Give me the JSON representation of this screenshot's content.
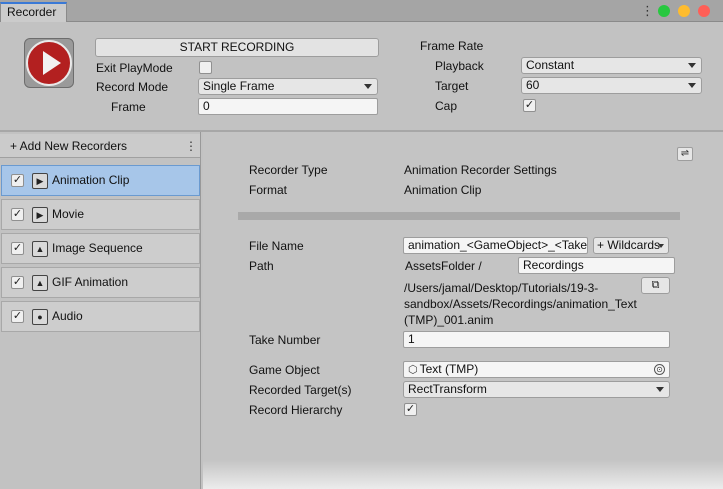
{
  "window": {
    "tab_title": "Recorder",
    "more_icon": "⋮",
    "traffic_lights": [
      "#28c840",
      "#febc2e",
      "#ff5f57"
    ]
  },
  "top": {
    "record_icon": "play-record-icon",
    "start_label": "START RECORDING",
    "exit_playmode_label": "Exit PlayMode",
    "exit_playmode_checked": false,
    "record_mode_label": "Record Mode",
    "record_mode_value": "Single Frame",
    "frame_label": "Frame",
    "frame_value": "0",
    "frame_rate_label": "Frame Rate",
    "playback_label": "Playback",
    "playback_value": "Constant",
    "target_label": "Target",
    "target_value": "60",
    "cap_label": "Cap",
    "cap_checked": true,
    "check_glyph": "✓"
  },
  "left": {
    "add_label": "+ Add New Recorders",
    "menu_icon": "⋮",
    "recorders": [
      {
        "label": "Animation Clip",
        "icon": "animation-clip-icon",
        "glyph": "▶",
        "checked": true,
        "selected": true
      },
      {
        "label": "Movie",
        "icon": "movie-icon",
        "glyph": "▶",
        "checked": true,
        "selected": false
      },
      {
        "label": "Image Sequence",
        "icon": "image-sequence-icon",
        "glyph": "▲",
        "checked": true,
        "selected": false
      },
      {
        "label": "GIF Animation",
        "icon": "gif-animation-icon",
        "glyph": "▲",
        "checked": true,
        "selected": false
      },
      {
        "label": "Audio",
        "icon": "audio-icon",
        "glyph": "●",
        "checked": true,
        "selected": false
      }
    ]
  },
  "right": {
    "settings_icon": "⇌",
    "recorder_type_label": "Recorder Type",
    "recorder_type_value": "Animation Recorder Settings",
    "format_label": "Format",
    "format_value": "Animation Clip",
    "file_name_label": "File Name",
    "file_name_value": "animation_<GameObject>_<Take>",
    "wildcards_label": "+ Wildcards",
    "path_label": "Path",
    "path_root": "AssetsFolder /",
    "path_folder": "Recordings",
    "path_full": "/Users/jamal/Desktop/Tutorials/19-3-sandbox/Assets/Recordings/animation_Text (TMP)_001.anim",
    "open_folder_icon": "⧉",
    "take_number_label": "Take Number",
    "take_number_value": "1",
    "game_object_label": "Game Object",
    "game_object_value": "Text (TMP)",
    "game_object_icon": "⬡",
    "picker_icon": "⊙",
    "recorded_targets_label": "Recorded Target(s)",
    "recorded_targets_value": "RectTransform",
    "record_hierarchy_label": "Record Hierarchy",
    "record_hierarchy_checked": true
  }
}
